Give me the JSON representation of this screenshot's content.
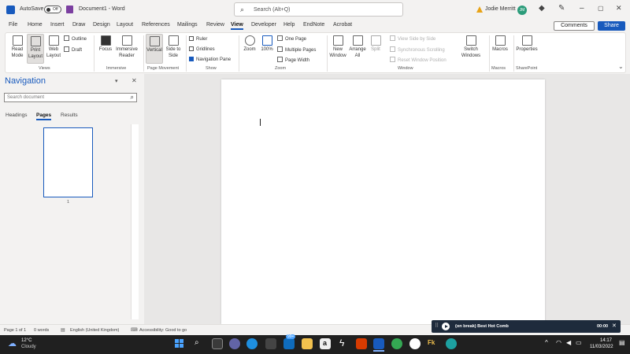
{
  "titlebar": {
    "autosave_label": "AutoSave",
    "autosave_state": "Off",
    "doc_title": "Document1 - Word",
    "search_placeholder": "Search (Alt+Q)",
    "user_name": "Jodie Merritt",
    "user_initials": "JM"
  },
  "tabs": [
    "File",
    "Home",
    "Insert",
    "Draw",
    "Design",
    "Layout",
    "References",
    "Mailings",
    "Review",
    "View",
    "Developer",
    "Help",
    "EndNote",
    "Acrobat"
  ],
  "active_tab": "View",
  "actions": {
    "comments": "Comments",
    "share": "Share"
  },
  "ribbon": {
    "views": {
      "read_mode": "Read Mode",
      "print_layout": "Print Layout",
      "web_layout": "Web Layout",
      "outline": "Outline",
      "draft": "Draft",
      "group": "Views"
    },
    "immersive": {
      "focus": "Focus",
      "immersive_reader": "Immersive Reader",
      "group": "Immersive"
    },
    "page_movement": {
      "vertical": "Vertical",
      "side_to_side": "Side to Side",
      "group": "Page Movement"
    },
    "show": {
      "ruler": "Ruler",
      "gridlines": "Gridlines",
      "navigation_pane": "Navigation Pane",
      "group": "Show"
    },
    "zoom": {
      "zoom": "Zoom",
      "pct": "100%",
      "one_page": "One Page",
      "multiple_pages": "Multiple Pages",
      "page_width": "Page Width",
      "group": "Zoom"
    },
    "window": {
      "new_window": "New Window",
      "arrange_all": "Arrange All",
      "split": "Split",
      "view_side": "View Side by Side",
      "sync_scroll": "Synchronous Scrolling",
      "reset_pos": "Reset Window Position",
      "switch_windows": "Switch Windows",
      "group": "Window"
    },
    "macros": {
      "macros": "Macros",
      "group": "Macros"
    },
    "sharepoint": {
      "properties": "Properties",
      "group": "SharePoint"
    }
  },
  "nav": {
    "title": "Navigation",
    "search_placeholder": "Search document",
    "tabs": [
      "Headings",
      "Pages",
      "Results"
    ],
    "active_tab": "Pages",
    "page_number": "1"
  },
  "status": {
    "page": "Page 1 of 1",
    "words": "0 words",
    "language": "English (United Kingdom)",
    "accessibility": "Accessibility: Good to go"
  },
  "media": {
    "title": "(on break) Best Hot Comb",
    "time": "00:00"
  },
  "taskbar": {
    "weather_temp": "12°C",
    "weather_desc": "Cloudy",
    "time": "14:17",
    "date": "11/03/2022",
    "badge_count": "99+"
  },
  "colors": {
    "accent": "#185abd",
    "taskbar": "#202020"
  }
}
